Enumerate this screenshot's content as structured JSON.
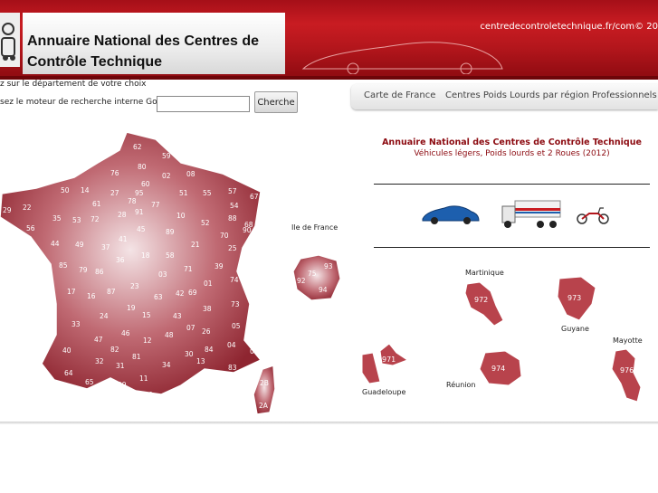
{
  "header": {
    "title_line1": "Annuaire National des Centres de",
    "title_line2": "Contrôle Technique",
    "site": "centredecontroletechnique.fr/com© 20"
  },
  "search": {
    "instructions_line1": "z sur le département de votre choix",
    "instructions_line2": "sez le moteur de recherche interne Google",
    "input_value": "",
    "button_label": "Cherche"
  },
  "nav": {
    "tabs": [
      {
        "label": "Carte de France"
      },
      {
        "label": "Centres Poids Lourds par région"
      },
      {
        "label": "Professionnels"
      }
    ]
  },
  "map": {
    "ile_de_france_label": "Ile de France",
    "departments": [
      "62",
      "59",
      "80",
      "02",
      "08",
      "76",
      "60",
      "50",
      "14",
      "27",
      "78",
      "95",
      "77",
      "51",
      "55",
      "57",
      "67",
      "29",
      "22",
      "56",
      "35",
      "53",
      "72",
      "61",
      "28",
      "91",
      "10",
      "52",
      "54",
      "88",
      "68",
      "44",
      "49",
      "37",
      "41",
      "45",
      "89",
      "21",
      "70",
      "90",
      "85",
      "79",
      "86",
      "36",
      "18",
      "58",
      "71",
      "39",
      "25",
      "17",
      "16",
      "87",
      "23",
      "03",
      "42",
      "69",
      "01",
      "74",
      "73",
      "33",
      "24",
      "19",
      "15",
      "63",
      "43",
      "07",
      "26",
      "38",
      "05",
      "47",
      "46",
      "12",
      "48",
      "30",
      "84",
      "04",
      "06",
      "40",
      "82",
      "81",
      "34",
      "13",
      "83",
      "64",
      "65",
      "32",
      "31",
      "09",
      "11",
      "66",
      "2B",
      "2A"
    ],
    "idf_departments": [
      "93",
      "75",
      "92",
      "94"
    ]
  },
  "info": {
    "title": "Annuaire National des Centres de Contrôle Technique",
    "subtitle": "Véhicules légers, Poids lourds et 2 Roues (2012)"
  },
  "vehicles": {
    "car": "car-icon",
    "truck": "truck-icon",
    "scooter": "scooter-icon"
  },
  "dom_tom": [
    {
      "name": "Martinique",
      "code": "972"
    },
    {
      "name": "Guyane",
      "code": "973"
    },
    {
      "name": "Mayotte",
      "code": "976"
    },
    {
      "name": "Guadeloupe",
      "code": "971"
    },
    {
      "name": "Réunion",
      "code": "974"
    }
  ],
  "colors": {
    "brand_red": "#b3161c",
    "map_red": "#a8343d",
    "title_red": "#8c0a10"
  }
}
